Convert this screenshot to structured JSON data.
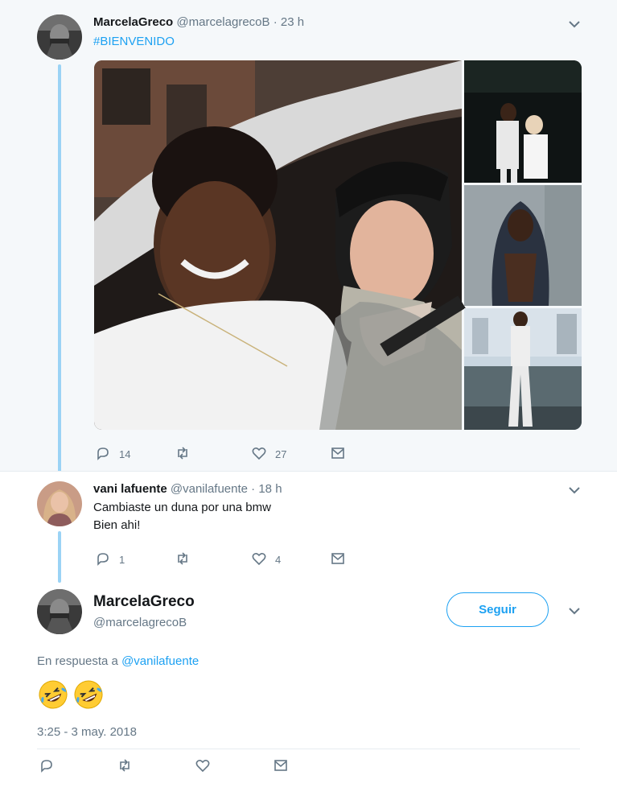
{
  "tweet1": {
    "name": "MarcelaGreco",
    "handle": "@marcelagrecoB",
    "separator": "·",
    "time": "23 h",
    "text": "#BIENVENIDO",
    "actions": {
      "replies": "14",
      "retweets": "",
      "likes": "27"
    },
    "icons": {
      "reply": "reply-icon",
      "retweet": "retweet-icon",
      "like": "heart-icon",
      "dm": "envelope-icon",
      "menu": "chevron-down-icon"
    }
  },
  "tweet2": {
    "name": "vani lafuente",
    "handle": "@vanilafuente",
    "separator": "·",
    "time": "18 h",
    "text_line1": "Cambiaste un duna por una bmw",
    "text_line2": "Bien ahi!",
    "actions": {
      "replies": "1",
      "retweets": "",
      "likes": "4"
    }
  },
  "tweet3": {
    "name": "MarcelaGreco",
    "handle": "@marcelagrecoB",
    "follow_label": "Seguir",
    "reply_prefix": "En respuesta a",
    "reply_mention": "@vanilafuente",
    "emoji": "🤣",
    "timestamp": "3:25 - 3 may. 2018"
  },
  "colors": {
    "accent": "#1da1f2",
    "muted": "#657786",
    "thread_line": "#9bd3f5",
    "tweet_bg": "#f5f8fa"
  }
}
